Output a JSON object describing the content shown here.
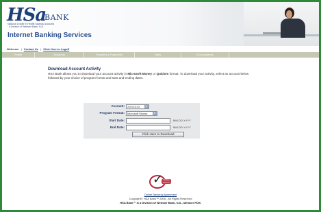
{
  "header": {
    "logo_main": "HSa",
    "logo_bank": "BANK",
    "logo_tagline": "National Leader in Health Savings Accounts · A Division of Webster Bank, N.A.",
    "site_title": "Internet Banking Services"
  },
  "welcome": {
    "label": "Welcome",
    "links": [
      "Contact Us",
      "Click Here to Logoff"
    ]
  },
  "nav": {
    "items": [
      "Profile",
      "Accounts",
      "Transfers & Payments",
      "Tools",
      "E-Documents",
      ""
    ]
  },
  "content": {
    "title": "Download Account Activity",
    "desc_part1": "HSA Bank allows you to download your account activity in ",
    "desc_bold1": "Microsoft Money",
    "desc_part2": " or ",
    "desc_bold2": "Quicken",
    "desc_part3": " format. To download your activity, select an account below followed by your choice of program format and start and ending dates."
  },
  "form": {
    "account_label": "Account:",
    "account_value": "XXXXXXX",
    "program_label": "Program Format:",
    "program_value": "Microsoft Money",
    "start_label": "Start Date:",
    "start_value": "",
    "start_hint": "MM-DD-YYYY",
    "end_label": "End Date:",
    "end_value": "",
    "end_hint": "MM-DD-YYYY",
    "download_label": "Click Here to Download"
  },
  "footer": {
    "seal_text": "VeriSign Secured",
    "link": "Online Banking Agreement",
    "copyright": "Copyright© HSA Bank™ 2005 - All Rights Reserved",
    "disclaimer": "HSA Bank™ is a Division of Webster Bank, N.A., Member FDIC"
  }
}
